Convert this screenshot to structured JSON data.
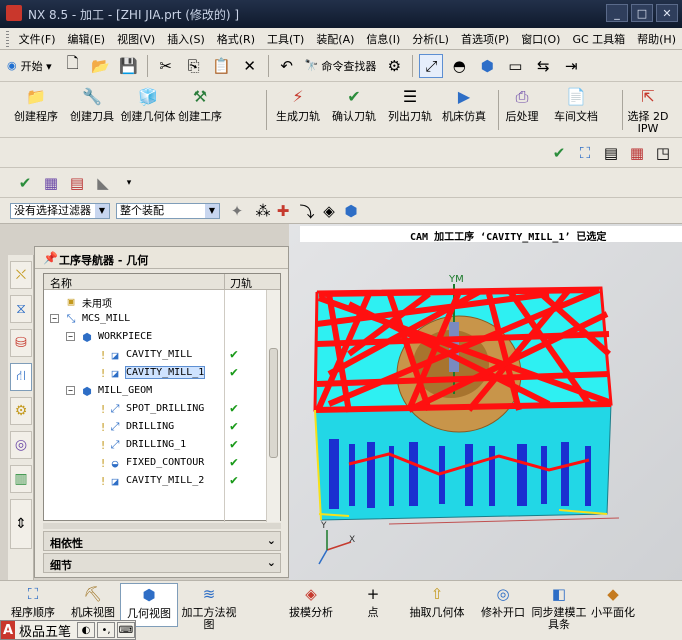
{
  "window": {
    "title": "NX 8.5 - 加工 - [ZHI JIA.prt  (修改的) ]"
  },
  "menu": [
    "文件(F)",
    "编辑(E)",
    "视图(V)",
    "插入(S)",
    "格式(R)",
    "工具(T)",
    "装配(A)",
    "信息(I)",
    "分析(L)",
    "首选项(P)",
    "窗口(O)",
    "GC 工具箱",
    "帮助(H)"
  ],
  "toolbar1": {
    "start_label": "开始 ▾",
    "command_finder": "命令查找器"
  },
  "toolbar2": {
    "create_program": "创建程序",
    "create_tool": "创建刀具",
    "create_geometry": "创建几何体",
    "create_operation": "创建工序",
    "generate_path": "生成刀轨",
    "confirm_path": "确认刀轨",
    "list_path": "列出刀轨",
    "machine_sim": "机床仿真",
    "postprocess": "后处理",
    "shop_doc": "车间文档",
    "select_2d": "选择 2D IPW"
  },
  "filterbar": {
    "filter": "没有选择过滤器",
    "assembly": "整个装配"
  },
  "status": {
    "message": "CAM 加工工序 ‘CAVITY_MILL_1’ 已选定"
  },
  "navigator": {
    "title": "工序导航器 - 几何",
    "col_name": "名称",
    "col_path": "刀轨",
    "rows": [
      {
        "label": "未用项",
        "icon": "folder-icon",
        "status": ""
      },
      {
        "label": "MCS_MILL",
        "icon": "mcs-icon",
        "status": ""
      },
      {
        "label": "WORKPIECE",
        "icon": "workpiece-icon",
        "status": ""
      },
      {
        "label": "CAVITY_MILL",
        "icon": "cavity-mill-icon",
        "status": "✔"
      },
      {
        "label": "CAVITY_MILL_1",
        "icon": "cavity-mill-icon",
        "status": "✔"
      },
      {
        "label": "MILL_GEOM",
        "icon": "mill-geom-icon",
        "status": ""
      },
      {
        "label": "SPOT_DRILLING",
        "icon": "spot-drill-icon",
        "status": "✔"
      },
      {
        "label": "DRILLING",
        "icon": "drill-icon",
        "status": "✔"
      },
      {
        "label": "DRILLING_1",
        "icon": "drill-icon",
        "status": "✔"
      },
      {
        "label": "FIXED_CONTOUR",
        "icon": "contour-icon",
        "status": "✔"
      },
      {
        "label": "CAVITY_MILL_2",
        "icon": "cavity-mill-icon",
        "status": "✔"
      }
    ],
    "panel_dependency": "相依性",
    "panel_details": "细节"
  },
  "viewport": {
    "axis_ym": "YM",
    "axis_x": "X",
    "axis_y": "Y"
  },
  "bottombar": {
    "program_order": "程序顺序",
    "machine_view": "机床视图",
    "geometry_view": "几何视图",
    "method_view": "加工方法视图",
    "draft_analysis": "拔模分析",
    "point": "点",
    "extract_geometry": "抽取几何体",
    "patch_opening": "修补开口",
    "sync_modeling": "同步建模工具条",
    "small_flat": "小平面化"
  },
  "ime": {
    "label": "极品五笔"
  }
}
